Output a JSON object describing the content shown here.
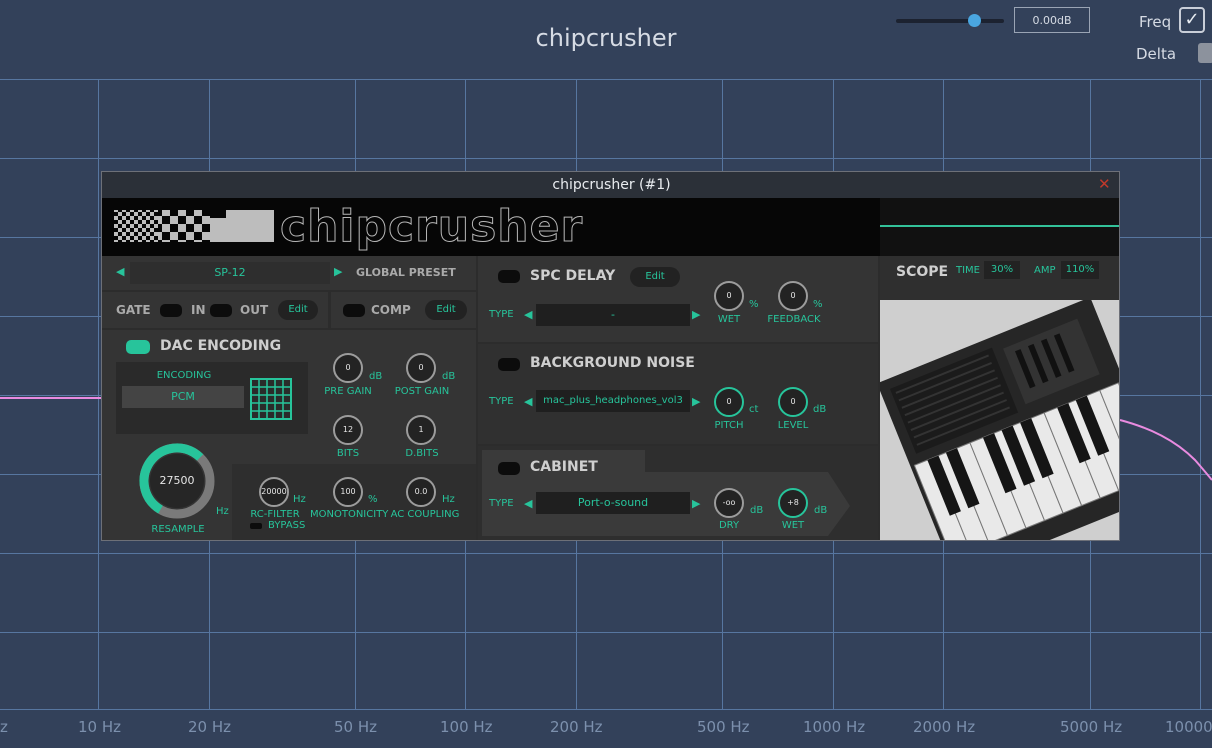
{
  "host": {
    "title": "chipcrusher",
    "gain_value": "0.00dB",
    "slider_level": 0.72,
    "freq_label": "Freq",
    "freq_checked": "✓",
    "delta_label": "Delta",
    "freq_ticks": [
      "z",
      "10 Hz",
      "20 Hz",
      "50 Hz",
      "100 Hz",
      "200 Hz",
      "500 Hz",
      "1000 Hz",
      "2000 Hz",
      "5000 Hz",
      "10000"
    ]
  },
  "plugin": {
    "window_title": "chipcrusher (#1)",
    "close_glyph": "✕",
    "logo_text": "chipcrusher",
    "preset": {
      "value": "SP-12",
      "label": "GLOBAL PRESET"
    },
    "gate": {
      "label": "GATE",
      "in": "IN",
      "out": "OUT",
      "edit": "Edit"
    },
    "comp": {
      "label": "COMP",
      "edit": "Edit"
    },
    "dac": {
      "title": "DAC ENCODING",
      "encoding_label": "ENCODING",
      "encoding_value": "PCM",
      "pre_gain": {
        "value": "0",
        "unit": "dB",
        "label": "PRE GAIN"
      },
      "post_gain": {
        "value": "0",
        "unit": "dB",
        "label": "POST GAIN"
      },
      "bits": {
        "value": "12",
        "label": "BITS"
      },
      "dbits": {
        "value": "1",
        "label": "D.BITS"
      },
      "resample": {
        "value": "27500",
        "unit": "Hz",
        "label": "RESAMPLE",
        "level": 0.65
      },
      "rc_filter": {
        "value": "20000",
        "unit": "Hz",
        "label": "RC-FILTER"
      },
      "bypass": "BYPASS",
      "monotonicity": {
        "value": "100",
        "unit": "%",
        "label": "MONOTONICITY"
      },
      "ac_coupling": {
        "value": "0.0",
        "unit": "Hz",
        "label": "AC COUPLING"
      }
    },
    "spc_delay": {
      "title": "SPC DELAY",
      "edit": "Edit",
      "type_label": "TYPE",
      "type_value": "-",
      "wet": {
        "value": "0",
        "unit": "%",
        "label": "WET"
      },
      "feedback": {
        "value": "0",
        "unit": "%",
        "label": "FEEDBACK"
      }
    },
    "background_noise": {
      "title": "BACKGROUND NOISE",
      "type_label": "TYPE",
      "type_value": "mac_plus_headphones_vol3",
      "pitch": {
        "value": "0",
        "unit": "ct",
        "label": "PITCH"
      },
      "level": {
        "value": "0",
        "unit": "dB",
        "label": "LEVEL"
      }
    },
    "cabinet": {
      "title": "CABINET",
      "type_label": "TYPE",
      "type_value": "Port-o-sound",
      "dry": {
        "value": "-oo",
        "unit": "dB",
        "label": "DRY"
      },
      "wet": {
        "value": "+8",
        "unit": "dB",
        "label": "WET"
      }
    },
    "scope": {
      "title": "SCOPE",
      "time_label": "TIME",
      "time_value": "30%",
      "amp_label": "AMP",
      "amp_value": "110%"
    }
  },
  "colors": {
    "accent": "#27c49b",
    "host_bg": "#33415a",
    "grid": "#5776a0",
    "curve": "#e98be0"
  }
}
